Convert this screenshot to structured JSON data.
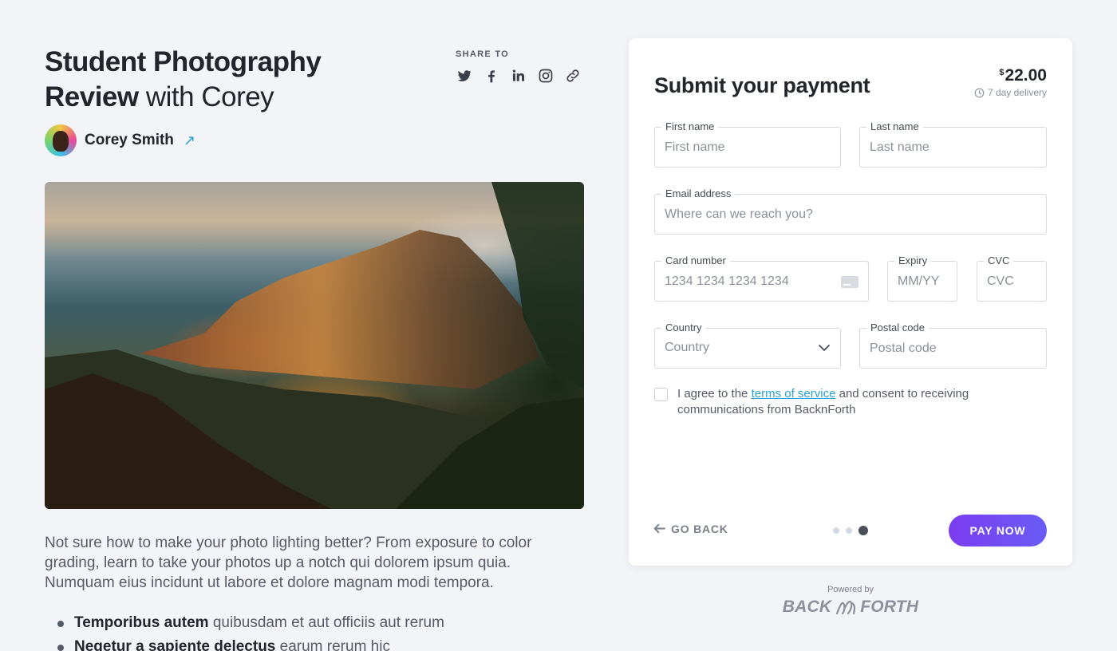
{
  "course": {
    "title_bold_1": "Student Photography",
    "title_bold_2": "Review",
    "title_light": "with Corey",
    "share_label": "SHARE TO",
    "share_icons": [
      "twitter-icon",
      "facebook-icon",
      "linkedin-icon",
      "instagram-icon",
      "link-icon"
    ],
    "author_name": "Corey Smith",
    "description": "Not sure how to make your photo lighting better? From exposure to color grading, learn to take your photos up a notch qui dolorem ipsum quia. Numquam eius incidunt ut labore et dolore magnam modi tempora.",
    "bullets": [
      {
        "bold": "Temporibus autem",
        "rest": "quibusdam et aut officiis aut rerum"
      },
      {
        "bold": "Neqetur a sapiente delectus",
        "rest": "earum rerum hic"
      }
    ]
  },
  "payment": {
    "title": "Submit your payment",
    "currency": "$",
    "amount": "22.00",
    "delivery": "7 day delivery",
    "fields": {
      "first_name": {
        "label": "First name",
        "placeholder": "First name",
        "value": ""
      },
      "last_name": {
        "label": "Last name",
        "placeholder": "Last name",
        "value": ""
      },
      "email": {
        "label": "Email address",
        "placeholder": "Where can we reach you?",
        "value": ""
      },
      "card_number": {
        "label": "Card number",
        "placeholder": "1234 1234 1234 1234",
        "value": ""
      },
      "expiry": {
        "label": "Expiry",
        "placeholder": "MM/YY",
        "value": ""
      },
      "cvc": {
        "label": "CVC",
        "placeholder": "CVC",
        "value": ""
      },
      "country": {
        "label": "Country",
        "selected": "Country"
      },
      "postal_code": {
        "label": "Postal code",
        "placeholder": "Postal code",
        "value": ""
      }
    },
    "agree_prefix": "I agree to the",
    "agree_link": "terms of service",
    "agree_suffix": "and consent to receiving communications from BacknForth",
    "go_back": "GO BACK",
    "step_current": 3,
    "step_total": 3,
    "pay_button": "PAY NOW"
  },
  "footer": {
    "powered_by": "Powered by",
    "brand_left": "BACK",
    "brand_right": "FORTH"
  },
  "colors": {
    "accent": "#2aa1d8",
    "pay_gradient_start": "#7b3cf0",
    "pay_gradient_end": "#6a5cf5",
    "background": "#f3f4f7"
  }
}
